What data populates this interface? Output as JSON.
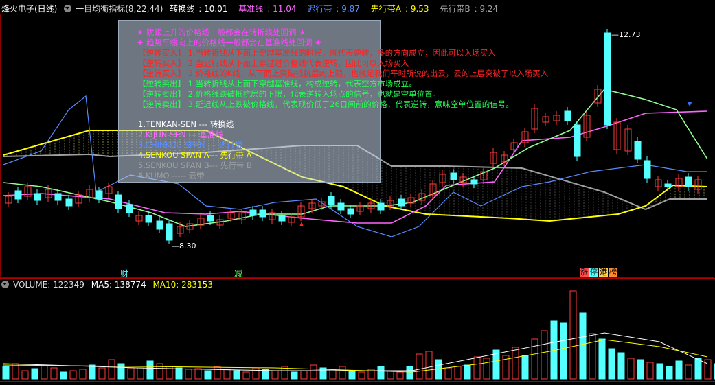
{
  "header": {
    "stock_name": "烽火电子(日线)",
    "indicator_name": "一目均衡指标(8,22,44)",
    "conversion": {
      "label": "转换线",
      "value": "10.01",
      "color": "#ffffff"
    },
    "base": {
      "label": "基准线",
      "value": "11.04",
      "color": "#ff66ff"
    },
    "lagging": {
      "label": "迟行带",
      "value": "9.87",
      "color": "#5a8cff"
    },
    "span_a": {
      "label": "先行带A",
      "value": "9.53",
      "color": "#ffff00"
    },
    "span_b": {
      "label": "先行带B",
      "value": "9.24",
      "color": "#a0a0a0"
    }
  },
  "legend": {
    "star1": "★  犹跟上升的价格线一般都会在转折线处回调 ★",
    "star2": "★  趋势平缓向上的价格线一般都会在基准线处回调 ★",
    "buy1": "【逆转买入】  1.当转折线从下而上穿越基准线的时候，就代表逆转，多的方向成立，因此可以入场买入",
    "buy2": "【逆转买入】  2.当迟行线从下而上穿越过价格线代表逆转，因此可以入场买入",
    "buy3": "【逆转买入】  3.价格线的K线，从下而上突破抵抗层的上限，也就是我们平时所说的出云，云的上层突破了以入场买入",
    "sell1": "【逆转卖出】  1.当转折线从上而下穿越基准线，构成逆转，代表空方市场成立。",
    "sell2": "【逆转卖出】  2.价格线跌破抵抗层的下限，代表逆转入场点的信号，也就是空单位置。",
    "sell3": "【逆转卖出】  3.延迟线从上跌破价格线，代表现价低于26日间前的价格，代表逆转，意味空单位置的信号。",
    "item1": "1.TENKAN-SEN   ---   转换线",
    "item2": "2.KIJUN-SEN    ---   基准线",
    "item3": "3.CHINKOU SPAN  ---  迟行带",
    "item4": "4.SENKOU SPAN A---  先行带 A",
    "item5": "5.SENKOU SPAN B---  先行带 B",
    "item6": "6.KUMO          -----   云带"
  },
  "markers": {
    "high": "12.73",
    "low": "8.30",
    "cai": "财",
    "jian": "减",
    "badges": [
      "涨",
      "停",
      "港",
      "榜"
    ]
  },
  "volume_header": {
    "volume": "VOLUME: 122349",
    "ma5": "MA5: 138774",
    "ma10": "MA10: 283153"
  },
  "colors": {
    "up": "#ff3c3c",
    "down": "#54ffff",
    "conversion": "#ffffff",
    "base": "#ff66ff",
    "lagging": "#5a8cff",
    "span_a": "#ffff00",
    "span_b": "#a0a0a0",
    "green_line": "#90ff90"
  }
}
